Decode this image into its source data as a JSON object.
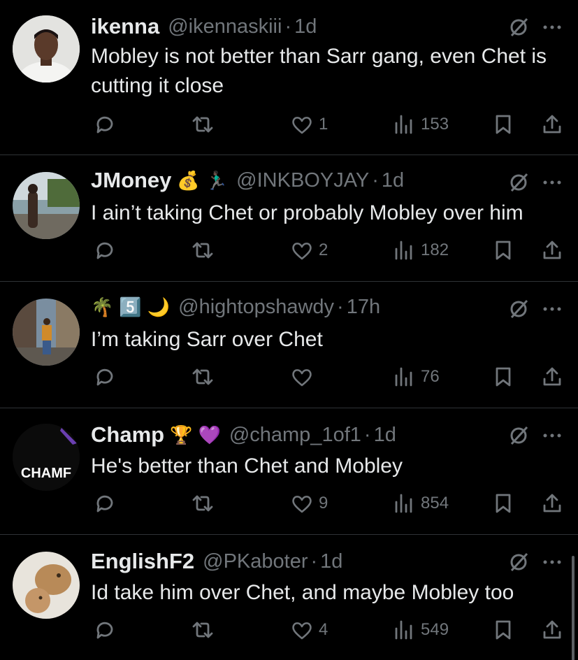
{
  "tweets": [
    {
      "display_name": "ikenna",
      "handle": "@ikennaskiii",
      "time": "1d",
      "text": "Mobley is not better than Sarr gang, even Chet is cutting it close",
      "likes": "1",
      "views": "153",
      "avatar": "photo-man-white-shirt"
    },
    {
      "display_name": "JMoney",
      "name_emojis": [
        "💰",
        "🏃🏿‍♂️"
      ],
      "handle": "@INKBOYJAY",
      "time": "1d",
      "text": "I ain’t taking Chet or probably Mobley over him",
      "likes": "2",
      "views": "182",
      "avatar": "photo-person-outdoors"
    },
    {
      "display_name": "",
      "name_emojis": [
        "🌴",
        "5️⃣",
        "🌙"
      ],
      "handle": "@hightopshawdy",
      "time": "17h",
      "text": "I’m taking Sarr over Chet",
      "likes": "",
      "views": "76",
      "avatar": "photo-street-scene"
    },
    {
      "display_name": "Champ",
      "name_emojis": [
        "🏆",
        "💜"
      ],
      "handle": "@champ_1of1",
      "time": "1d",
      "text": "He's better than Chet and Mobley",
      "likes": "9",
      "views": "854",
      "avatar_text": "CHAMF"
    },
    {
      "display_name": "EnglishF2",
      "handle": "@PKaboter",
      "time": "1d",
      "text": "Id take him over Chet, and maybe Mobley too",
      "likes": "4",
      "views": "549",
      "avatar": "photo-lions"
    }
  ],
  "separator": "·",
  "icons": [
    "reply-icon",
    "retweet-icon",
    "like-icon",
    "views-icon",
    "bookmark-icon",
    "share-icon",
    "grok-icon",
    "more-icon"
  ],
  "colors": {
    "background": "#000000",
    "text": "#e7e9ea",
    "muted": "#71767b",
    "divider": "#2f3336"
  }
}
